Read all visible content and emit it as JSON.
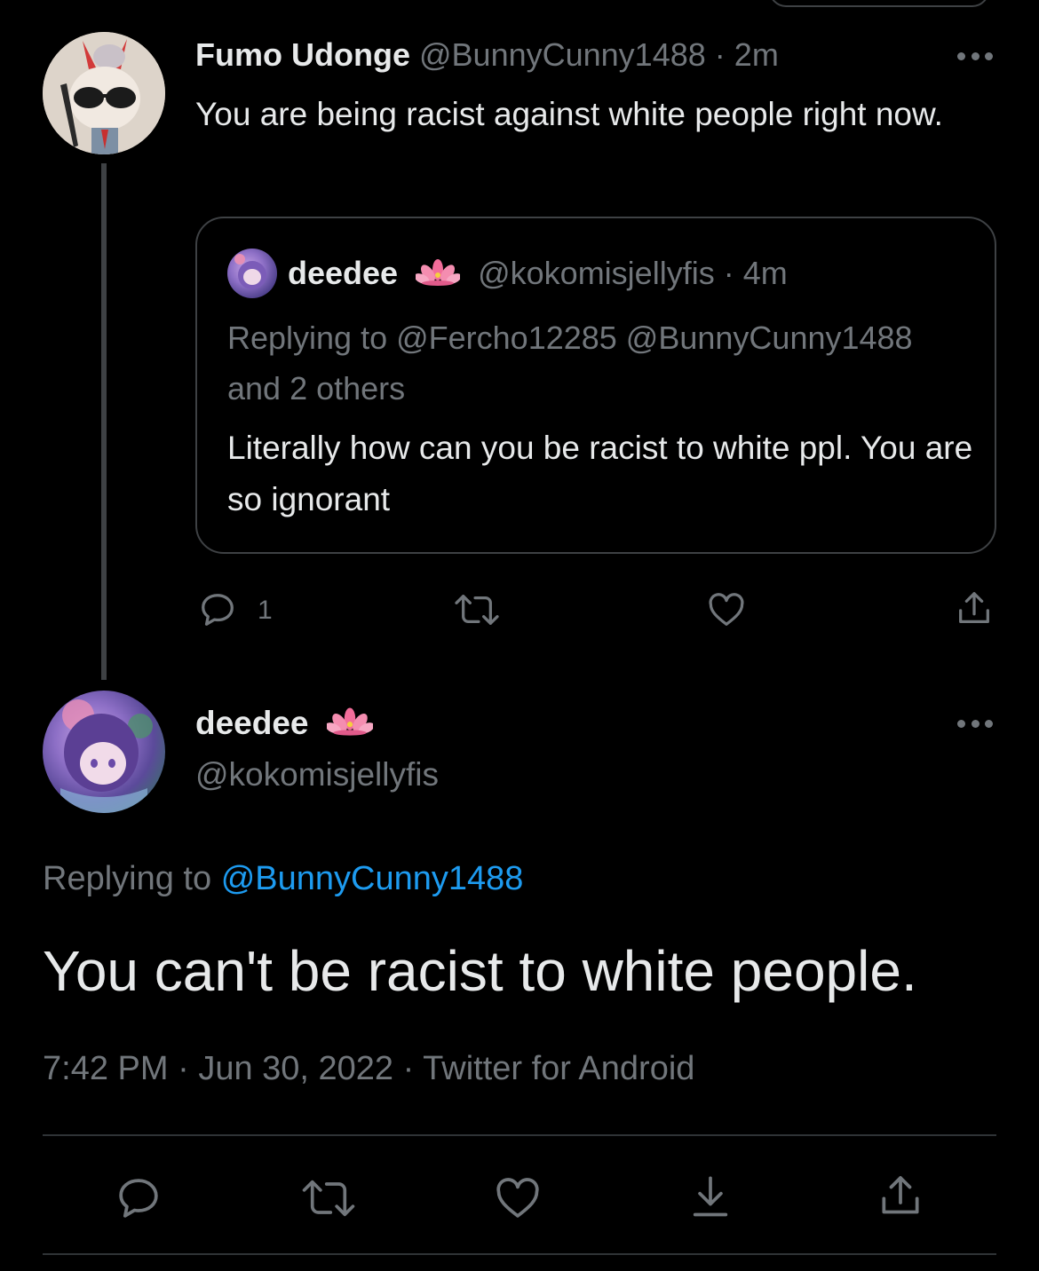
{
  "colors": {
    "background": "#000000",
    "text_primary": "#e7e9ea",
    "text_secondary": "#71767b",
    "border": "#2f3336",
    "link": "#1d9bf0"
  },
  "reply_tweet": {
    "display_name": "Fumo Udonge",
    "handle": "@BunnyCunny1488",
    "separator": "·",
    "time": "2m",
    "text": "You are being racist against white people right now.",
    "avatar_icon": "plush-avatar",
    "quoted_tweet": {
      "display_name": "deedee",
      "badge_icon": "lotus-emoji",
      "handle": "@kokomisjellyfis",
      "separator": "·",
      "time": "4m",
      "replying_to": "Replying to @Fercho12285 @BunnyCunny1488 and 2 others",
      "text": "Literally how can you be racist to white ppl. You are so ignorant"
    },
    "actions": {
      "reply_count": "1"
    }
  },
  "main_tweet": {
    "display_name": "deedee",
    "badge_icon": "lotus-emoji",
    "handle": "@kokomisjellyfis",
    "replying_label": "Replying to",
    "replying_handle": "@BunnyCunny1488",
    "text": "You can't be racist to white people.",
    "time": "7:42 PM",
    "date": "Jun 30, 2022",
    "source": "Twitter for Android",
    "separator": "·"
  }
}
